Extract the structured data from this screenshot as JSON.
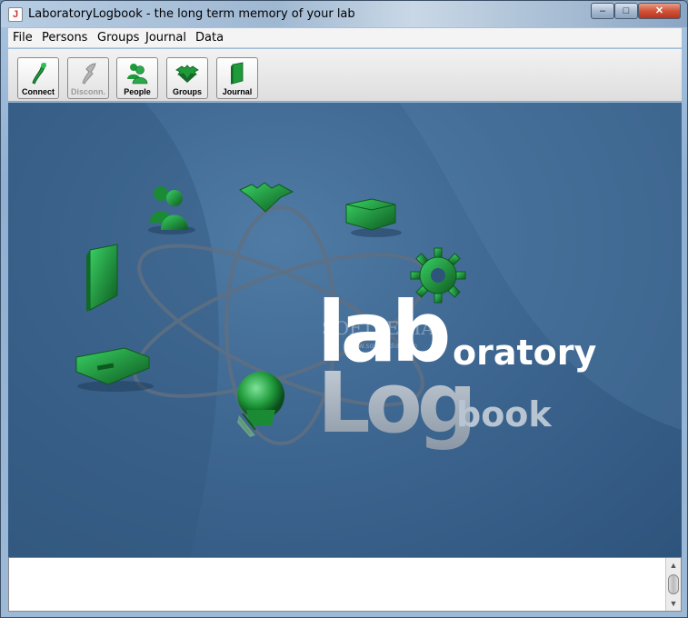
{
  "window": {
    "title": "LaboratoryLogbook - the long term memory of your lab",
    "minimize_glyph": "–",
    "maximize_glyph": "□",
    "close_glyph": "✕"
  },
  "menu": {
    "items": [
      "File",
      "Persons",
      "Groups",
      "Journal",
      "Data"
    ]
  },
  "toolbar": {
    "buttons": [
      {
        "label": "Connect",
        "icon": "connect-icon",
        "enabled": true
      },
      {
        "label": "Disconn.",
        "icon": "disconnect-icon",
        "enabled": false
      },
      {
        "label": "People",
        "icon": "people-icon",
        "enabled": true
      },
      {
        "label": "Groups",
        "icon": "groups-icon",
        "enabled": true
      },
      {
        "label": "Journal",
        "icon": "journal-icon",
        "enabled": true
      }
    ]
  },
  "splash": {
    "logo_lab": "lab",
    "logo_oratory": "oratory",
    "logo_log": "Log",
    "logo_book": "book",
    "watermark": "SOFTPEDIA",
    "watermark_url": "www.softpedia.com"
  },
  "colors": {
    "accent_green": "#1f9a3a",
    "background_blue": "#3d6690"
  }
}
